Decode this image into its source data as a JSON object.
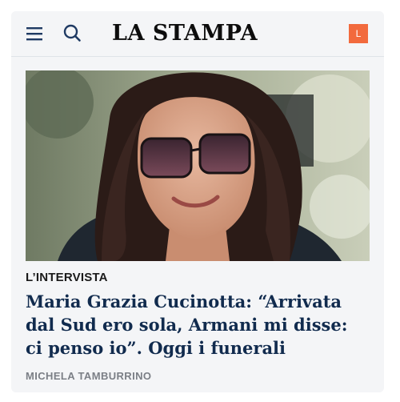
{
  "header": {
    "logo_text": "LA STAMPA",
    "menu_icon": "hamburger-menu-icon",
    "search_icon": "search-icon",
    "avatar_letter": "L",
    "avatar_color": "#f26a3d"
  },
  "article": {
    "kicker": "L’INTERVISTA",
    "headline": "Maria Grazia Cucinotta: “Arrivata dal Sud ero sola, Armani mi disse: ci penso io”. Oggi i funerali",
    "author": "MICHELA TAMBURRINO",
    "headline_color": "#112b4e"
  }
}
